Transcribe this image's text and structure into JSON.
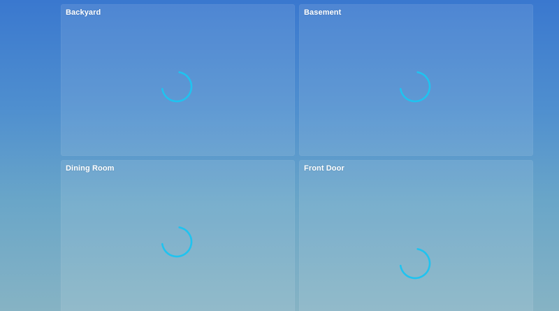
{
  "colors": {
    "spinner": "#1fc3f0"
  },
  "cameras": [
    {
      "label": "Backyard",
      "status": "loading"
    },
    {
      "label": "Basement",
      "status": "loading"
    },
    {
      "label": "Dining Room",
      "status": "loading"
    },
    {
      "label": "Front Door",
      "status": "loading"
    }
  ]
}
